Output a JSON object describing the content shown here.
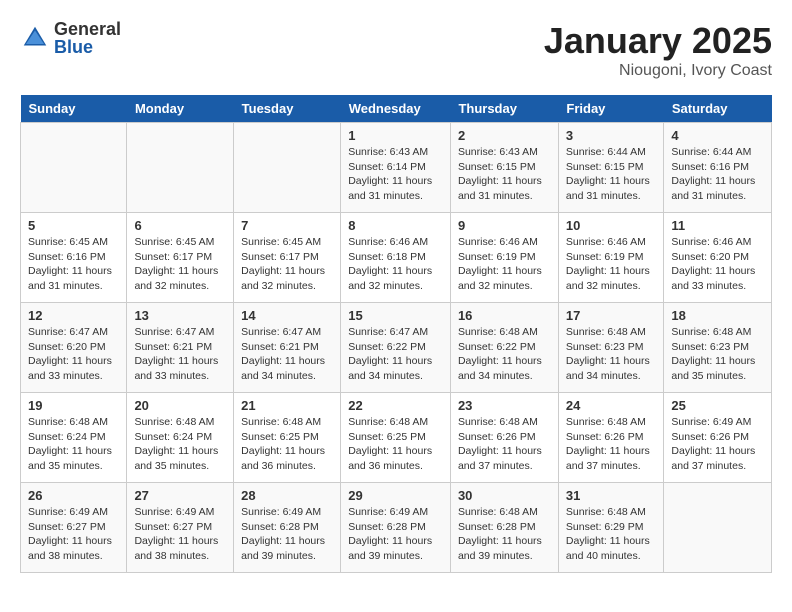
{
  "logo": {
    "general": "General",
    "blue": "Blue"
  },
  "title": "January 2025",
  "subtitle": "Niougoni, Ivory Coast",
  "days_of_week": [
    "Sunday",
    "Monday",
    "Tuesday",
    "Wednesday",
    "Thursday",
    "Friday",
    "Saturday"
  ],
  "weeks": [
    [
      {
        "day": "",
        "info": ""
      },
      {
        "day": "",
        "info": ""
      },
      {
        "day": "",
        "info": ""
      },
      {
        "day": "1",
        "info": "Sunrise: 6:43 AM\nSunset: 6:14 PM\nDaylight: 11 hours\nand 31 minutes."
      },
      {
        "day": "2",
        "info": "Sunrise: 6:43 AM\nSunset: 6:15 PM\nDaylight: 11 hours\nand 31 minutes."
      },
      {
        "day": "3",
        "info": "Sunrise: 6:44 AM\nSunset: 6:15 PM\nDaylight: 11 hours\nand 31 minutes."
      },
      {
        "day": "4",
        "info": "Sunrise: 6:44 AM\nSunset: 6:16 PM\nDaylight: 11 hours\nand 31 minutes."
      }
    ],
    [
      {
        "day": "5",
        "info": "Sunrise: 6:45 AM\nSunset: 6:16 PM\nDaylight: 11 hours\nand 31 minutes."
      },
      {
        "day": "6",
        "info": "Sunrise: 6:45 AM\nSunset: 6:17 PM\nDaylight: 11 hours\nand 32 minutes."
      },
      {
        "day": "7",
        "info": "Sunrise: 6:45 AM\nSunset: 6:17 PM\nDaylight: 11 hours\nand 32 minutes."
      },
      {
        "day": "8",
        "info": "Sunrise: 6:46 AM\nSunset: 6:18 PM\nDaylight: 11 hours\nand 32 minutes."
      },
      {
        "day": "9",
        "info": "Sunrise: 6:46 AM\nSunset: 6:19 PM\nDaylight: 11 hours\nand 32 minutes."
      },
      {
        "day": "10",
        "info": "Sunrise: 6:46 AM\nSunset: 6:19 PM\nDaylight: 11 hours\nand 32 minutes."
      },
      {
        "day": "11",
        "info": "Sunrise: 6:46 AM\nSunset: 6:20 PM\nDaylight: 11 hours\nand 33 minutes."
      }
    ],
    [
      {
        "day": "12",
        "info": "Sunrise: 6:47 AM\nSunset: 6:20 PM\nDaylight: 11 hours\nand 33 minutes."
      },
      {
        "day": "13",
        "info": "Sunrise: 6:47 AM\nSunset: 6:21 PM\nDaylight: 11 hours\nand 33 minutes."
      },
      {
        "day": "14",
        "info": "Sunrise: 6:47 AM\nSunset: 6:21 PM\nDaylight: 11 hours\nand 34 minutes."
      },
      {
        "day": "15",
        "info": "Sunrise: 6:47 AM\nSunset: 6:22 PM\nDaylight: 11 hours\nand 34 minutes."
      },
      {
        "day": "16",
        "info": "Sunrise: 6:48 AM\nSunset: 6:22 PM\nDaylight: 11 hours\nand 34 minutes."
      },
      {
        "day": "17",
        "info": "Sunrise: 6:48 AM\nSunset: 6:23 PM\nDaylight: 11 hours\nand 34 minutes."
      },
      {
        "day": "18",
        "info": "Sunrise: 6:48 AM\nSunset: 6:23 PM\nDaylight: 11 hours\nand 35 minutes."
      }
    ],
    [
      {
        "day": "19",
        "info": "Sunrise: 6:48 AM\nSunset: 6:24 PM\nDaylight: 11 hours\nand 35 minutes."
      },
      {
        "day": "20",
        "info": "Sunrise: 6:48 AM\nSunset: 6:24 PM\nDaylight: 11 hours\nand 35 minutes."
      },
      {
        "day": "21",
        "info": "Sunrise: 6:48 AM\nSunset: 6:25 PM\nDaylight: 11 hours\nand 36 minutes."
      },
      {
        "day": "22",
        "info": "Sunrise: 6:48 AM\nSunset: 6:25 PM\nDaylight: 11 hours\nand 36 minutes."
      },
      {
        "day": "23",
        "info": "Sunrise: 6:48 AM\nSunset: 6:26 PM\nDaylight: 11 hours\nand 37 minutes."
      },
      {
        "day": "24",
        "info": "Sunrise: 6:48 AM\nSunset: 6:26 PM\nDaylight: 11 hours\nand 37 minutes."
      },
      {
        "day": "25",
        "info": "Sunrise: 6:49 AM\nSunset: 6:26 PM\nDaylight: 11 hours\nand 37 minutes."
      }
    ],
    [
      {
        "day": "26",
        "info": "Sunrise: 6:49 AM\nSunset: 6:27 PM\nDaylight: 11 hours\nand 38 minutes."
      },
      {
        "day": "27",
        "info": "Sunrise: 6:49 AM\nSunset: 6:27 PM\nDaylight: 11 hours\nand 38 minutes."
      },
      {
        "day": "28",
        "info": "Sunrise: 6:49 AM\nSunset: 6:28 PM\nDaylight: 11 hours\nand 39 minutes."
      },
      {
        "day": "29",
        "info": "Sunrise: 6:49 AM\nSunset: 6:28 PM\nDaylight: 11 hours\nand 39 minutes."
      },
      {
        "day": "30",
        "info": "Sunrise: 6:48 AM\nSunset: 6:28 PM\nDaylight: 11 hours\nand 39 minutes."
      },
      {
        "day": "31",
        "info": "Sunrise: 6:48 AM\nSunset: 6:29 PM\nDaylight: 11 hours\nand 40 minutes."
      },
      {
        "day": "",
        "info": ""
      }
    ]
  ]
}
